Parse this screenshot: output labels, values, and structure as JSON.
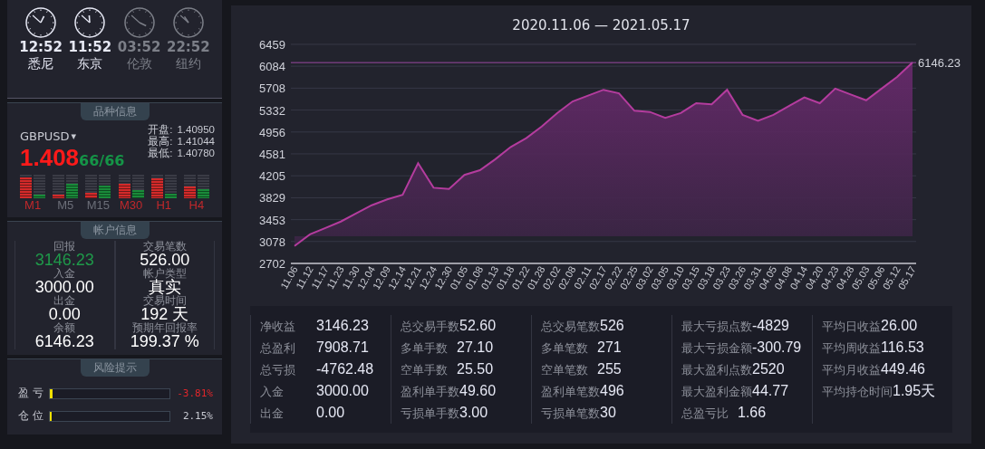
{
  "clocks": [
    {
      "time": "12:52",
      "city": "悉尼",
      "highlighted": true
    },
    {
      "time": "11:52",
      "city": "东京",
      "highlighted": true
    },
    {
      "time": "03:52",
      "city": "伦敦",
      "highlighted": false
    },
    {
      "time": "22:52",
      "city": "纽约",
      "highlighted": false
    }
  ],
  "symbol_panel": {
    "title": "品种信息",
    "symbol": "GBPUSD",
    "dropdown": "▾",
    "price": "1.408",
    "price_tail": "66/66",
    "quotes": [
      {
        "label": "开盘:",
        "value": "1.40950"
      },
      {
        "label": "最高:",
        "value": "1.41044"
      },
      {
        "label": "最低:",
        "value": "1.40780"
      }
    ],
    "timeframes": [
      {
        "label": "M1",
        "color": "#c0282b",
        "level": 0.9
      },
      {
        "label": "M5",
        "color": "#6b6e78",
        "level": 0.15
      },
      {
        "label": "M15",
        "color": "#6b6e78",
        "level": 0.25
      },
      {
        "label": "M30",
        "color": "#c0282b",
        "level": 0.6
      },
      {
        "label": "H1",
        "color": "#c0282b",
        "level": 0.85
      },
      {
        "label": "H4",
        "color": "#c0282b",
        "level": 0.5
      }
    ]
  },
  "account_panel": {
    "title": "帐户信息",
    "items": [
      {
        "label": "回报",
        "value": "3146.23",
        "color": "#1f9a4a"
      },
      {
        "label": "交易笔数",
        "value": "526.00",
        "color": "#ffffff"
      },
      {
        "label": "入金",
        "value": "3000.00",
        "color": "#ffffff"
      },
      {
        "label": "帐户类型",
        "value": "真实",
        "color": "#ffffff"
      },
      {
        "label": "出金",
        "value": "0.00",
        "color": "#ffffff"
      },
      {
        "label": "交易时间",
        "value": "192 天",
        "color": "#ffffff"
      },
      {
        "label": "余额",
        "value": "6146.23",
        "color": "#ffffff"
      },
      {
        "label": "预期年回报率",
        "value": "199.37 %",
        "color": "#ffffff"
      }
    ]
  },
  "risk_panel": {
    "title": "风险提示",
    "rows": [
      {
        "label": "盈 亏",
        "level": 0.02,
        "value": "-3.81%",
        "color": "#e0262b"
      },
      {
        "label": "仓 位",
        "level": 0.01,
        "value": "2.15%",
        "color": "#c8cad2"
      }
    ]
  },
  "chart": {
    "chart_data": {
      "type": "area",
      "title": "2020.11.06 — 2021.05.17",
      "categories": [
        "11.06",
        "11.12",
        "11.17",
        "11.23",
        "11.30",
        "12.04",
        "12.09",
        "12.14",
        "12.21",
        "12.24",
        "12.30",
        "01.05",
        "01.08",
        "01.13",
        "01.18",
        "01.22",
        "01.28",
        "02.02",
        "02.08",
        "02.11",
        "02.17",
        "02.22",
        "02.25",
        "03.02",
        "03.05",
        "03.10",
        "03.15",
        "03.18",
        "03.23",
        "03.26",
        "03.31",
        "04.05",
        "04.08",
        "04.14",
        "04.20",
        "04.23",
        "04.28",
        "05.03",
        "05.06",
        "05.12",
        "05.17"
      ],
      "series": [
        {
          "color": "#b43c9e",
          "values": [
            3000,
            3200,
            3310,
            3420,
            3560,
            3700,
            3800,
            3880,
            4420,
            4000,
            3980,
            4220,
            4300,
            4490,
            4700,
            4850,
            5050,
            5280,
            5480,
            5580,
            5680,
            5620,
            5320,
            5300,
            5200,
            5280,
            5450,
            5430,
            5680,
            5250,
            5150,
            5250,
            5400,
            5550,
            5450,
            5700,
            5600,
            5500,
            5700,
            5900,
            6150
          ]
        }
      ],
      "grid": true,
      "ylim": [
        2702,
        6459
      ],
      "yticks": [
        2702,
        3078,
        3453,
        3829,
        4205,
        4581,
        4956,
        5332,
        5708,
        6084,
        6459
      ],
      "ref_lines": [
        {
          "axis": "y",
          "value": 6146.23,
          "label": "6146.23"
        }
      ]
    }
  },
  "stats": [
    [
      {
        "label": "净收益",
        "value": "3146.23"
      },
      {
        "label": "总盈利",
        "value": "7908.71"
      },
      {
        "label": "总亏损",
        "value": "-4762.48"
      },
      {
        "label": "入金",
        "value": "3000.00"
      },
      {
        "label": "出金",
        "value": "0.00"
      }
    ],
    [
      {
        "label": "总交易手数",
        "value": "52.60"
      },
      {
        "label": "多单手数",
        "value": "27.10"
      },
      {
        "label": "空单手数",
        "value": "25.50"
      },
      {
        "label": "盈利单手数",
        "value": "49.60"
      },
      {
        "label": "亏损单手数",
        "value": "3.00"
      }
    ],
    [
      {
        "label": "总交易笔数",
        "value": "526"
      },
      {
        "label": "多单笔数",
        "value": "271"
      },
      {
        "label": "空单笔数",
        "value": "255"
      },
      {
        "label": "盈利单笔数",
        "value": "496"
      },
      {
        "label": "亏损单笔数",
        "value": "30"
      }
    ],
    [
      {
        "label": "最大亏损点数",
        "value": "-4829"
      },
      {
        "label": "最大亏损金额",
        "value": "-300.79"
      },
      {
        "label": "最大盈利点数",
        "value": "2520"
      },
      {
        "label": "最大盈利金额",
        "value": "44.77"
      },
      {
        "label": "总盈亏比",
        "value": "1.66"
      }
    ],
    [
      {
        "label": "平均日收益",
        "value": "26.00"
      },
      {
        "label": "平均周收益",
        "value": "116.53"
      },
      {
        "label": "平均月收益",
        "value": "449.46"
      },
      {
        "label": "平均持仓时间",
        "value": "1.95天"
      }
    ]
  ]
}
